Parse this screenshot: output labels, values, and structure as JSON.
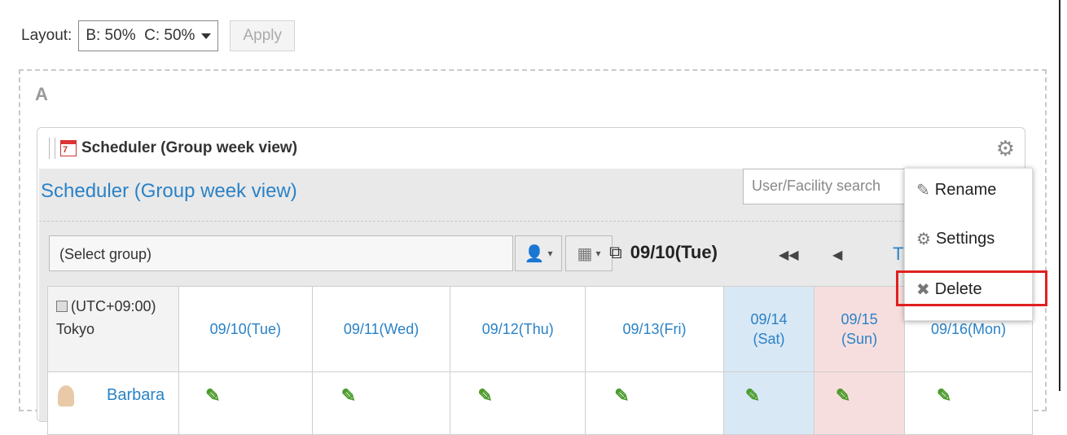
{
  "layout": {
    "label": "Layout:",
    "selected": "B: 50%  C: 50%",
    "apply_label": "Apply"
  },
  "region": {
    "label": "A"
  },
  "portlet": {
    "calendar_icon_digit": "7",
    "title": "Scheduler (Group week view)",
    "link_title": "Scheduler (Group week view)",
    "search_placeholder": "User/Facility search",
    "group_select": "(Select group)",
    "current_date": "09/10(Tue)",
    "today_label": "T"
  },
  "grid": {
    "timezone": "(UTC+09:00)",
    "city": "Tokyo",
    "days": [
      {
        "line1": "09/10(Tue)",
        "line2": ""
      },
      {
        "line1": "09/11(Wed)",
        "line2": ""
      },
      {
        "line1": "09/12(Thu)",
        "line2": ""
      },
      {
        "line1": "09/13(Fri)",
        "line2": ""
      },
      {
        "line1": "09/14",
        "line2": "(Sat)"
      },
      {
        "line1": "09/15",
        "line2": "(Sun)"
      },
      {
        "line1": "09/16(Mon)",
        "line2": ""
      }
    ],
    "users": [
      {
        "name": "Barbara"
      }
    ]
  },
  "menu": {
    "rename": "Rename",
    "settings": "Settings",
    "delete": "Delete"
  },
  "icons": {
    "gear": "gear-icon",
    "pencil": "pencil-icon",
    "delete": "x-icon",
    "person": "person-icon",
    "facility": "facility-icon",
    "copy": "copy-icon"
  },
  "colors": {
    "link": "#2a82c7",
    "saturday_bg": "#d9e8f5",
    "sunday_bg": "#f7dede",
    "highlight": "#e02020"
  }
}
